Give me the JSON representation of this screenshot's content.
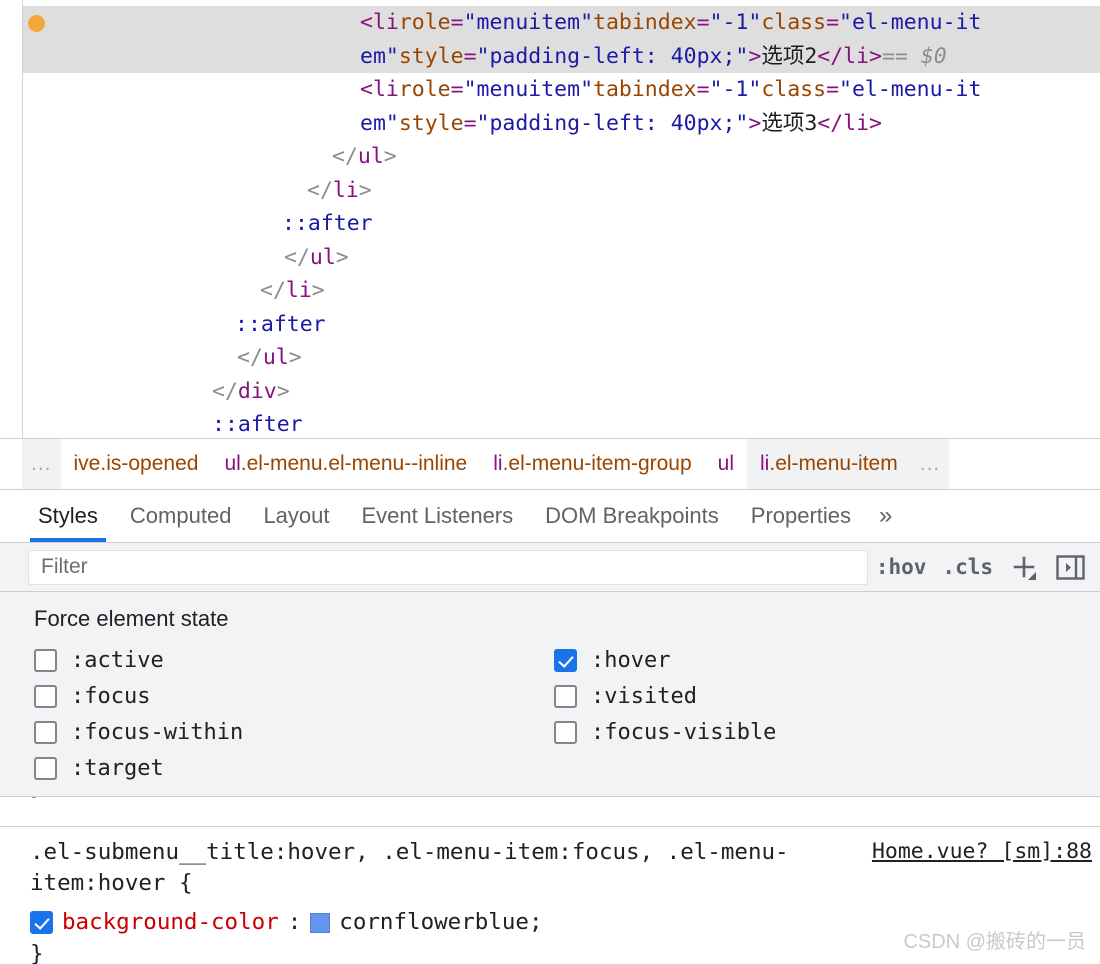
{
  "dom_tree": {
    "selected_badge": "breakpoint-dot",
    "lines": [
      {
        "indent": 0,
        "selected": true,
        "segments": [
          {
            "cls": "tok-tag",
            "t": "<li"
          },
          {
            "cls": "tok-text",
            "t": " "
          },
          {
            "cls": "tok-attr",
            "t": "role"
          },
          {
            "cls": "tok-tag",
            "t": "="
          },
          {
            "cls": "tok-val",
            "t": "\"menuitem\""
          },
          {
            "cls": "tok-text",
            "t": " "
          },
          {
            "cls": "tok-attr",
            "t": "tabindex"
          },
          {
            "cls": "tok-tag",
            "t": "="
          },
          {
            "cls": "tok-val",
            "t": "\"-1\""
          },
          {
            "cls": "tok-text",
            "t": " "
          },
          {
            "cls": "tok-attr",
            "t": "class"
          },
          {
            "cls": "tok-tag",
            "t": "="
          },
          {
            "cls": "tok-val",
            "t": "\"el-menu-it"
          }
        ]
      },
      {
        "indent": 0,
        "selected": true,
        "segments": [
          {
            "cls": "tok-val",
            "t": "em\""
          },
          {
            "cls": "tok-text",
            "t": " "
          },
          {
            "cls": "tok-attr",
            "t": "style"
          },
          {
            "cls": "tok-tag",
            "t": "="
          },
          {
            "cls": "tok-val",
            "t": "\"padding-left: 40px;\""
          },
          {
            "cls": "tok-tag",
            "t": ">"
          },
          {
            "cls": "tok-text",
            "t": "选项2"
          },
          {
            "cls": "tok-tag",
            "t": "</li>"
          },
          {
            "cls": "tok-gray",
            "t": " == "
          },
          {
            "cls": "tok-dollar",
            "t": "$0"
          }
        ]
      },
      {
        "indent": 0,
        "selected": false,
        "segments": [
          {
            "cls": "tok-tag",
            "t": "<li"
          },
          {
            "cls": "tok-text",
            "t": " "
          },
          {
            "cls": "tok-attr",
            "t": "role"
          },
          {
            "cls": "tok-tag",
            "t": "="
          },
          {
            "cls": "tok-val",
            "t": "\"menuitem\""
          },
          {
            "cls": "tok-text",
            "t": " "
          },
          {
            "cls": "tok-attr",
            "t": "tabindex"
          },
          {
            "cls": "tok-tag",
            "t": "="
          },
          {
            "cls": "tok-val",
            "t": "\"-1\""
          },
          {
            "cls": "tok-text",
            "t": " "
          },
          {
            "cls": "tok-attr",
            "t": "class"
          },
          {
            "cls": "tok-tag",
            "t": "="
          },
          {
            "cls": "tok-val",
            "t": "\"el-menu-it"
          }
        ]
      },
      {
        "indent": 0,
        "selected": false,
        "segments": [
          {
            "cls": "tok-val",
            "t": "em\""
          },
          {
            "cls": "tok-text",
            "t": " "
          },
          {
            "cls": "tok-attr",
            "t": "style"
          },
          {
            "cls": "tok-tag",
            "t": "="
          },
          {
            "cls": "tok-val",
            "t": "\"padding-left: 40px;\""
          },
          {
            "cls": "tok-tag",
            "t": ">"
          },
          {
            "cls": "tok-text",
            "t": "选项3"
          },
          {
            "cls": "tok-tag",
            "t": "</li>"
          }
        ]
      },
      {
        "indent": 0,
        "selected": false,
        "segments": [
          {
            "cls": "tok-close",
            "t": "      </"
          },
          {
            "cls": "tok-tag",
            "t": "ul"
          },
          {
            "cls": "tok-close",
            "t": ">"
          }
        ],
        "prefix": "    "
      },
      {
        "indent": 0,
        "selected": false,
        "segments": [
          {
            "cls": "tok-close",
            "t": "     </"
          },
          {
            "cls": "tok-tag",
            "t": "li"
          },
          {
            "cls": "tok-close",
            "t": ">"
          }
        ],
        "prefix": "   "
      },
      {
        "indent": 0,
        "selected": false,
        "segments": [
          {
            "cls": "tok-pseudo",
            "t": "      ::after"
          }
        ],
        "prefix": "   "
      },
      {
        "indent": 0,
        "selected": false,
        "segments": [
          {
            "cls": "tok-close",
            "t": "    </"
          },
          {
            "cls": "tok-tag",
            "t": "ul"
          },
          {
            "cls": "tok-close",
            "t": ">"
          }
        ],
        "prefix": "  "
      },
      {
        "indent": 0,
        "selected": false,
        "segments": [
          {
            "cls": "tok-close",
            "t": "   </"
          },
          {
            "cls": "tok-tag",
            "t": "li"
          },
          {
            "cls": "tok-close",
            "t": ">"
          }
        ],
        "prefix": "  "
      },
      {
        "indent": 0,
        "selected": false,
        "segments": [
          {
            "cls": "tok-pseudo",
            "t": "    ::after"
          }
        ],
        "prefix": "  "
      },
      {
        "indent": 0,
        "selected": false,
        "segments": [
          {
            "cls": "tok-close",
            "t": "  </"
          },
          {
            "cls": "tok-tag",
            "t": "ul"
          },
          {
            "cls": "tok-close",
            "t": ">"
          }
        ],
        "prefix": " "
      },
      {
        "indent": 0,
        "selected": false,
        "segments": [
          {
            "cls": "tok-close",
            "t": " </"
          },
          {
            "cls": "tok-tag",
            "t": "div"
          },
          {
            "cls": "tok-close",
            "t": ">"
          }
        ],
        "prefix": " "
      },
      {
        "indent": 0,
        "selected": false,
        "segments": [
          {
            "cls": "tok-pseudo",
            "t": "  ::after"
          }
        ],
        "prefix": " "
      },
      {
        "indent": 0,
        "selected": false,
        "segments": [
          {
            "cls": "tok-gray",
            "t": "  ..."
          }
        ],
        "prefix": " "
      }
    ]
  },
  "breadcrumb": {
    "leading_ellipsis": "...",
    "trailing_ellipsis": "...",
    "items": [
      {
        "tag": "",
        "cls": "ive.is-opened",
        "selected": false
      },
      {
        "tag": "ul",
        "cls": ".el-menu.el-menu--inline",
        "selected": false
      },
      {
        "tag": "li",
        "cls": ".el-menu-item-group",
        "selected": false
      },
      {
        "tag": "ul",
        "cls": "",
        "selected": false
      },
      {
        "tag": "li",
        "cls": ".el-menu-item",
        "selected": true
      }
    ]
  },
  "tabs": {
    "items": [
      {
        "label": "Styles",
        "active": true
      },
      {
        "label": "Computed",
        "active": false
      },
      {
        "label": "Layout",
        "active": false
      },
      {
        "label": "Event Listeners",
        "active": false
      },
      {
        "label": "DOM Breakpoints",
        "active": false
      },
      {
        "label": "Properties",
        "active": false
      }
    ],
    "overflow_label": "»"
  },
  "filter_bar": {
    "placeholder": "Filter",
    "value": "",
    "hov_label": ":hov",
    "cls_label": ".cls",
    "new_rule_icon": "plus-icon",
    "sidebar_toggle_icon": "sidebar-toggle-icon"
  },
  "force_state": {
    "title": "Force element state",
    "left": [
      {
        "label": ":active",
        "checked": false
      },
      {
        "label": ":focus",
        "checked": false
      },
      {
        "label": ":focus-within",
        "checked": false
      },
      {
        "label": ":target",
        "checked": false
      }
    ],
    "right": [
      {
        "label": ":hover",
        "checked": true
      },
      {
        "label": ":visited",
        "checked": false
      },
      {
        "label": ":focus-visible",
        "checked": false
      }
    ]
  },
  "cut_rule": {
    "text": "}"
  },
  "css_rule": {
    "selector": ".el-submenu__title:hover, .el-menu-item:focus, .el-menu-item:hover {",
    "origin": "Home.vue? [sm]:88",
    "declaration": {
      "enabled": true,
      "property": "background-color",
      "colon": ":",
      "value": "cornflowerblue;",
      "swatch_color": "#6495ed"
    },
    "closing_brace": "}"
  },
  "watermark": {
    "text": "CSDN @搬砖的一员"
  },
  "colors": {
    "accent_blue": "#1a73e8",
    "tag_purple": "#881280",
    "attr_brown": "#994500",
    "value_blue": "#1a1aa6",
    "prop_red": "#c80000",
    "selected_row_gray": "#dedede",
    "badge_orange": "#f0a938",
    "cornflowerblue": "#6495ed"
  }
}
